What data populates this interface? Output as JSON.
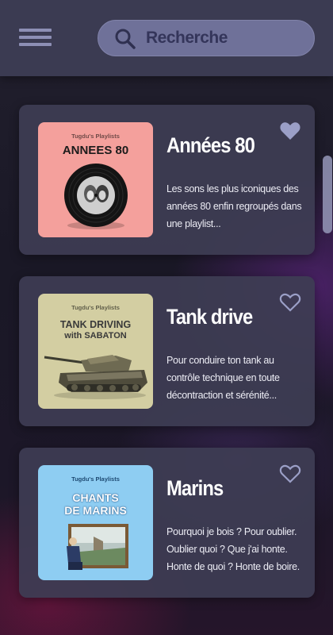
{
  "search": {
    "placeholder": "Recherche"
  },
  "playlists": [
    {
      "title": "Années 80",
      "description": "Les sons les plus iconiques des années 80 enfin regroupés dans une playlist...",
      "liked": true,
      "cover": {
        "brand": "Tugdu's Playlists",
        "title": "ANNEES 80",
        "background": "#f4a09c"
      }
    },
    {
      "title": "Tank drive",
      "description": "Pour conduire ton tank au contrôle technique en toute décontraction et sérénité...",
      "liked": false,
      "cover": {
        "brand": "Tugdu's Playlists",
        "title_line1": "TANK DRIVING",
        "title_line2": "with SABATON",
        "background": "#d3cea2"
      }
    },
    {
      "title": "Marins",
      "description": "Pourquoi je bois ? Pour oublier. Oublier quoi ? Que j'ai honte. Honte de quoi ? Honte de boire.",
      "liked": false,
      "cover": {
        "brand": "Tugdu's Playlists",
        "title_line1": "CHANTS",
        "title_line2": "DE MARINS",
        "background": "#8ecdf2"
      }
    }
  ],
  "colors": {
    "topbar": "#3b3b52",
    "search_field": "#6f7199",
    "card": "#3e3d54",
    "heart": "#9b9fc7",
    "text": "#ffffff"
  }
}
